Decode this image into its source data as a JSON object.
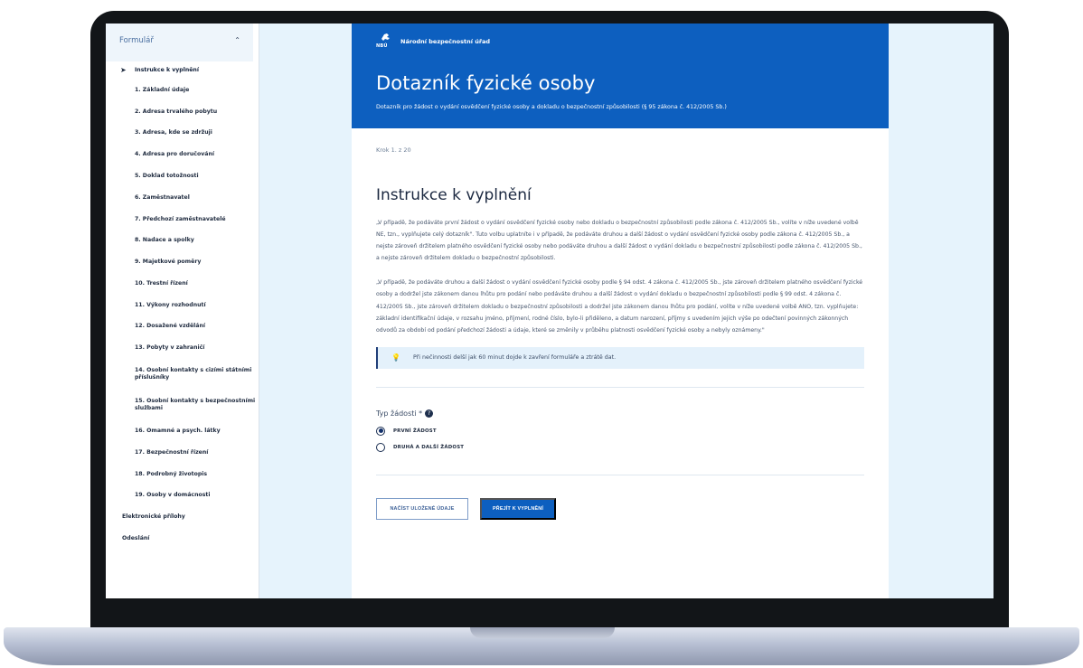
{
  "sidebar": {
    "title": "Formulář",
    "items": [
      {
        "label": "Instrukce k vyplnění"
      },
      {
        "label": "1. Základní údaje"
      },
      {
        "label": "2. Adresa trvalého pobytu"
      },
      {
        "label": "3. Adresa, kde se zdržuji"
      },
      {
        "label": "4. Adresa pro doručování"
      },
      {
        "label": "5. Doklad totožnosti"
      },
      {
        "label": "6. Zaměstnavatel"
      },
      {
        "label": "7. Předchozí zaměstnavatelé"
      },
      {
        "label": "8. Nadace a spolky"
      },
      {
        "label": "9. Majetkové poměry"
      },
      {
        "label": "10. Trestní řízení"
      },
      {
        "label": "11. Výkony rozhodnutí"
      },
      {
        "label": "12. Dosažené vzdělání"
      },
      {
        "label": "13. Pobyty v zahraničí"
      },
      {
        "label": "14. Osobní kontakty s cizími státními příslušníky"
      },
      {
        "label": "15. Osobní kontakty s bezpečnostními službami"
      },
      {
        "label": "16. Omamné a psych. látky"
      },
      {
        "label": "17. Bezpečnostní řízení"
      },
      {
        "label": "18. Podrobný životopis"
      },
      {
        "label": "19. Osoby v domácnosti"
      },
      {
        "label": "Elektronické přílohy"
      },
      {
        "label": "Odeslání"
      }
    ]
  },
  "header": {
    "agency": "Národní bezpečnostní úřad",
    "logo_text": "NBÚ",
    "title": "Dotazník fyzické osoby",
    "subtitle": "Dotazník pro žádost o vydání osvědčení fyzické osoby a dokladu o bezpečnostní způsobilosti (§ 95 zákona č. 412/2005 Sb.)"
  },
  "main": {
    "step": "Krok 1. z 20",
    "section_title": "Instrukce k vyplnění",
    "paragraph1": "„V případě, že podáváte první žádost o vydání osvědčení fyzické osoby nebo dokladu o bezpečnostní způsobilosti podle zákona č. 412/2005 Sb., volíte v níže uvedené volbě NE, tzn., vyplňujete celý dotazník\". Tuto volbu uplatníte i v případě, že podáváte druhou a další žádost o vydání osvědčení fyzické osoby podle zákona č. 412/2005 Sb., a nejste zároveň držitelem platného osvědčení fyzické osoby nebo podáváte druhou a další žádost o vydání dokladu o bezpečnostní způsobilosti podle zákona č. 412/2005 Sb., a nejste zároveň držitelem dokladu o bezpečnostní způsobilosti.",
    "paragraph2": "„V případě, že podáváte druhou a další žádost o vydání osvědčení fyzické osoby podle § 94 odst. 4 zákona č. 412/2005 Sb., jste zároveň držitelem platného osvědčení fyzické osoby a dodržel jste zákonem danou lhůtu pro podání nebo podáváte druhou a další žádost o vydání dokladu o bezpečnostní způsobilosti podle § 99 odst. 4 zákona č. 412/2005 Sb., jste zároveň držitelem dokladu o bezpečnostní způsobilosti a dodržel jste zákonem danou lhůtu pro podání, volíte v níže uvedené volbě ANO, tzn. vyplňujete: základní identifikační údaje, v rozsahu jméno, příjmení, rodné číslo, bylo-li přiděleno, a datum narození, příjmy s uvedením jejich výše po odečtení povinných zákonných odvodů za období od podání předchozí žádosti a údaje, které se změnily v průběhu platnosti osvědčení fyzické osoby a nebyly oznámeny.\"",
    "info": "Při nečinnosti delší jak 60 minut dojde k zavření formuláře a ztrátě dat.",
    "request_type_label": "Typ žádosti *",
    "help_glyph": "?",
    "options": [
      {
        "label": "PRVNÍ ŽÁDOST",
        "checked": true
      },
      {
        "label": "DRUHÁ A DALŠÍ ŽÁDOST",
        "checked": false
      }
    ],
    "btn_load": "NAČÍST ULOŽENÉ ÚDAJE",
    "btn_continue": "PŘEJÍT K VYPLNĚNÍ"
  },
  "icons": {
    "active_arrow": "chevron-right-icon",
    "collapse": "chevron-up-icon",
    "info": "lightbulb-icon",
    "help": "question-circle-icon",
    "logo": "lion-emblem-icon"
  },
  "colors": {
    "brand_blue": "#0d5fbf",
    "page_background": "#e6f3fc",
    "info_background": "#e4f1fb"
  }
}
